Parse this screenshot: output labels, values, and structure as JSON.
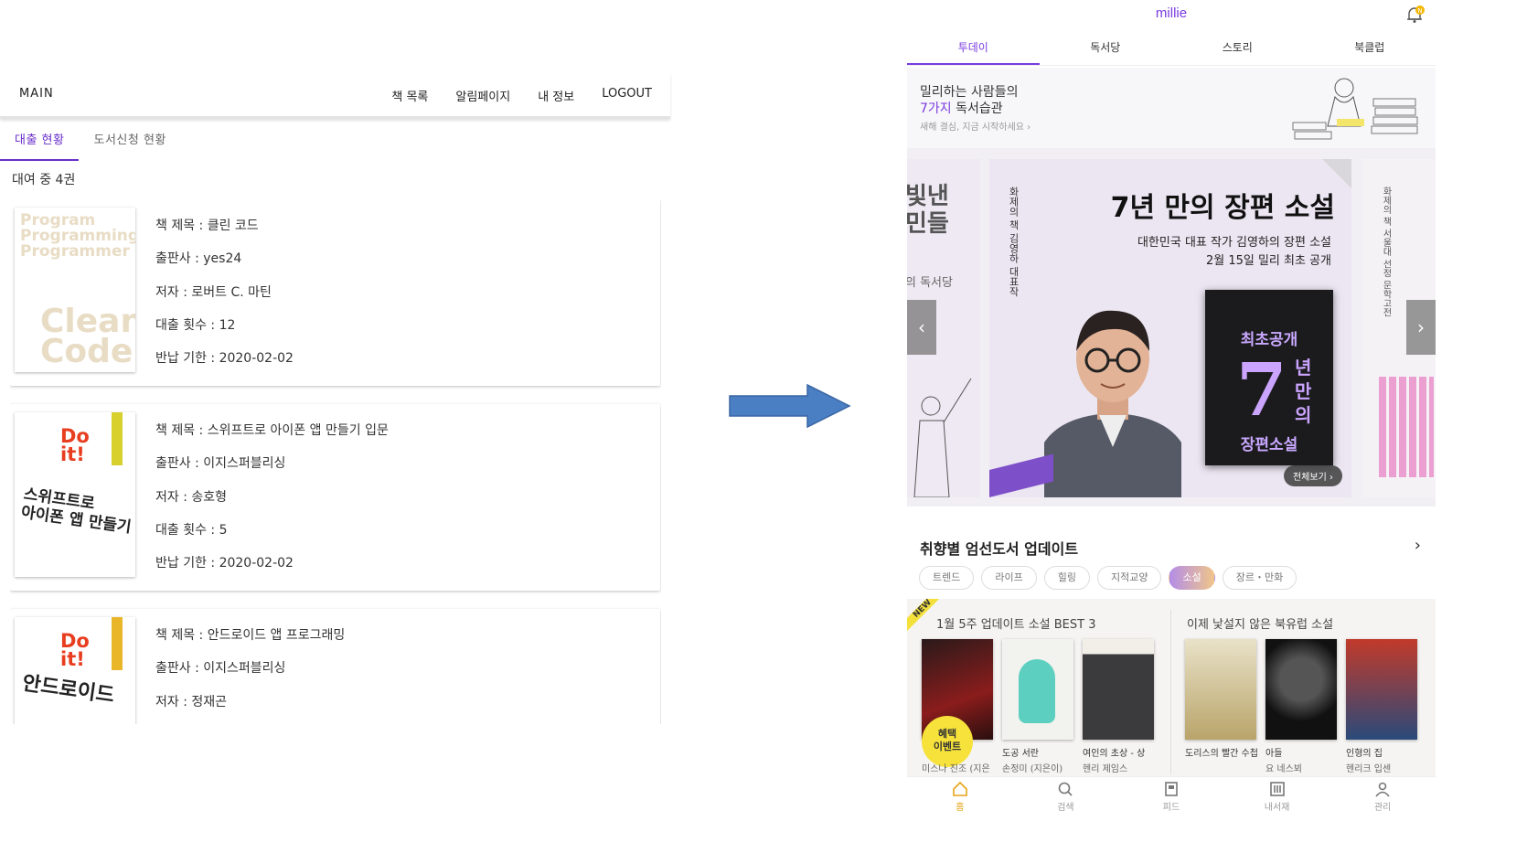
{
  "left_app": {
    "nav": {
      "main": "MAIN",
      "links": [
        "책 목록",
        "알림페이지",
        "내 정보",
        "LOGOUT"
      ]
    },
    "tabs": [
      "대출 현황",
      "도서신청 현황"
    ],
    "rental_count": "대여 중 4권",
    "cover_text": {
      "clean_top": "Program\nProgramming\nProgrammer",
      "clean_bottom": "Clean\nCode",
      "doit": "Do\nit!",
      "swift_cover": "스위프트로\n아이폰 앱 만들기",
      "android_cover": "안드로이드"
    },
    "books": [
      {
        "title": "책 제목 : 클린 코드",
        "publisher": "출판사 : yes24",
        "author": "저자 : 로버트 C. 마틴",
        "count": "대출 횟수 : 12",
        "due": "반납 기한 : 2020-02-02"
      },
      {
        "title": "책 제목 : 스위프트로 아이폰 앱 만들기 입문",
        "publisher": "출판사 : 이지스퍼블리싱",
        "author": "저자 : 송호형",
        "count": "대출 횟수 : 5",
        "due": "반납 기한 : 2020-02-02"
      },
      {
        "title": "책 제목 : 안드로이드 앱 프로그래밍",
        "publisher": "출판사 : 이지스퍼블리싱",
        "author": "저자 : 정재곤",
        "count": "",
        "due": ""
      }
    ]
  },
  "right_app": {
    "logo": "millie",
    "bell_badge": "N",
    "tabs": [
      "투데이",
      "독서당",
      "스토리",
      "북클럽"
    ],
    "banner": {
      "line1": "밀리하는 사람들의",
      "line2_highlight": "7가지",
      "line2_rest": " 독서습관",
      "line3": "새해 결심, 지금 시작하세요 ›"
    },
    "hero": {
      "title": "7년 만의 장편 소설",
      "sub1": "대한민국 대표 작가 김영하의 장편 소설",
      "sub2": "2월 15일 밀리 최초 공개",
      "vertical": "화제의 책 김영하 대표작",
      "book_top": "최초공개",
      "book_seven": "7",
      "book_side": "년만의",
      "book_bottom": "장편소설",
      "view_all": "전체보기 ›",
      "left_text": "빛낸\n민들",
      "left_sub": "의 독서당",
      "right_vertical": "화제의 책 서울대 선정 문학고전"
    },
    "section_title": "취향별 엄선도서 업데이트",
    "chips": [
      "트렌드",
      "라이프",
      "힐링",
      "지적교양",
      "소설",
      "장르・만화"
    ],
    "shelf": {
      "new_tag": "NEW",
      "heading1": "1월 5주 업데이트 소설 BEST 3",
      "heading2": "이제 낯설지 않은 북유럽 소설",
      "promo": "혜택\n이벤트",
      "books": [
        {
          "title": "",
          "author": "미스나 진조 (지은"
        },
        {
          "title": "도공 서란",
          "author": "손정미 (지은이)"
        },
        {
          "title": "여인의 초상 - 상",
          "author": "헨리 제임스"
        },
        {
          "title": "도리스의 빨간 수첩",
          "author": ""
        },
        {
          "title": "아들",
          "author": "요 네스뵈"
        },
        {
          "title": "인형의 집",
          "author": "헨리크 입센"
        }
      ]
    },
    "bottom_nav": [
      "홈",
      "검색",
      "피드",
      "내서재",
      "관리"
    ],
    "colors": {
      "accent": "#7a3be0",
      "home_active": "#e6a417",
      "chip_active_start": "#b48de8",
      "chip_active_end": "#f0c58a"
    }
  }
}
